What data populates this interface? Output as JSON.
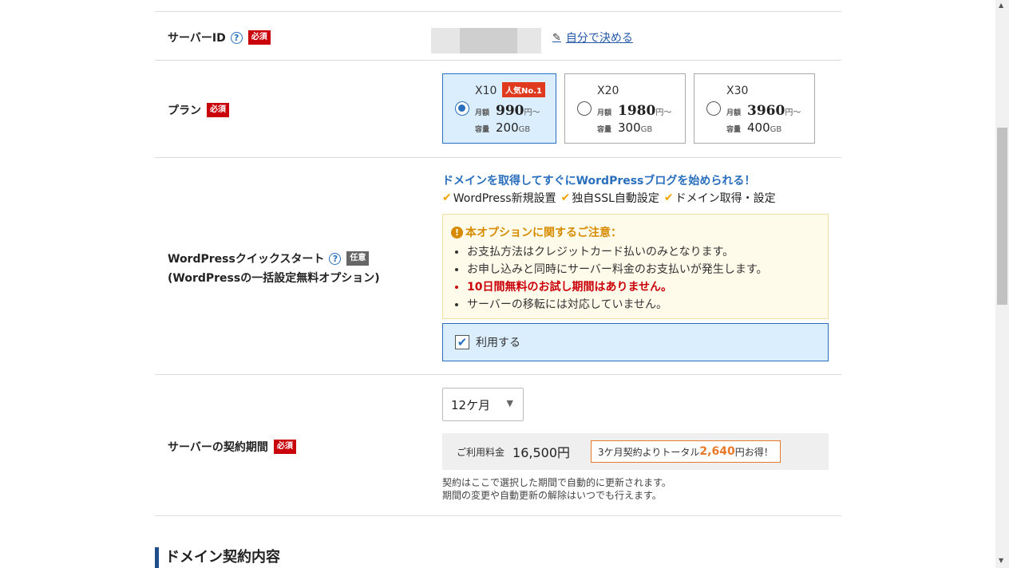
{
  "server_id": {
    "label": "サーバーID",
    "required": "必須",
    "help": "?",
    "self_link": "自分で決める"
  },
  "plan": {
    "label": "プラン",
    "required": "必須",
    "monthly_label": "月額",
    "capacity_label": "容量",
    "price_unit": "円～",
    "capacity_unit": "GB",
    "popular_badge": "人気No.1",
    "options": [
      {
        "name": "X10",
        "price": "990",
        "capacity": "200",
        "selected": true
      },
      {
        "name": "X20",
        "price": "1980",
        "capacity": "300",
        "selected": false
      },
      {
        "name": "X30",
        "price": "3960",
        "capacity": "400",
        "selected": false
      }
    ]
  },
  "wordpress": {
    "label": "WordPressクイックスタート",
    "sublabel": "(WordPressの一括設定無料オプション)",
    "optional": "任意",
    "help": "?",
    "headline": "ドメインを取得してすぐにWordPressブログを始められる！",
    "features": [
      "WordPress新規設置",
      "独自SSL自動設定",
      "ドメイン取得・設定"
    ],
    "notice_title": "本オプションに関するご注意：",
    "notice_items": [
      "お支払方法はクレジットカード払いのみとなります。",
      "お申し込みと同時にサーバー料金のお支払いが発生します。",
      "10日間無料のお試し期間はありません。",
      "サーバーの移転には対応していません。"
    ],
    "use_label": "利用する",
    "use_checked": true
  },
  "contract": {
    "label": "サーバーの契約期間",
    "required": "必須",
    "period_selected": "12ケ月",
    "fee_label": "ご利用料金",
    "fee_value": "16,500円",
    "promo_prefix": "3ケ月契約よりトータル",
    "promo_amount": "2,640",
    "promo_suffix": "円お得！",
    "note_line1": "契約はここで選択した期間で自動的に更新されます。",
    "note_line2": "期間の変更や自動更新の解除はいつでも行えます。"
  },
  "domain_section": {
    "title": "ドメイン契約内容"
  },
  "colors": {
    "required_red": "#c9000a",
    "accent_blue": "#2a6fbd",
    "selected_bg": "#dbeefd",
    "warning_orange": "#d68b00",
    "promo_orange": "#e8782a"
  }
}
